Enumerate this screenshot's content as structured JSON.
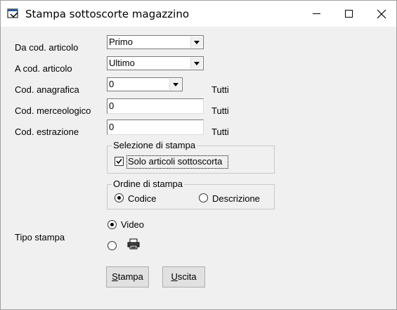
{
  "window": {
    "title": "Stampa sottoscorte magazzino",
    "icon": "app-window-icon",
    "controls": [
      "minimize-icon",
      "maximize-icon",
      "close-icon"
    ]
  },
  "fields": {
    "da_cod_articolo": {
      "label": "Da cod. articolo",
      "value": "Primo"
    },
    "a_cod_articolo": {
      "label": "A cod. articolo",
      "value": "Ultimo"
    },
    "cod_anagrafica": {
      "label": "Cod. anagrafica",
      "value": "0",
      "hint": "Tutti"
    },
    "cod_merceologico": {
      "label": "Cod. merceologico",
      "value": "0",
      "hint": "Tutti"
    },
    "cod_estrazione": {
      "label": "Cod. estrazione",
      "value": "0",
      "hint": "Tutti"
    }
  },
  "selezione": {
    "legend": "Selezione di stampa",
    "checkbox_label": "Solo articoli sottoscorta",
    "checked": true
  },
  "ordine": {
    "legend": "Ordine di stampa",
    "options": [
      "Codice",
      "Descrizione"
    ],
    "selected": "Codice"
  },
  "tipo_stampa": {
    "label": "Tipo stampa",
    "options": [
      "Video",
      "printer-icon"
    ],
    "selected": "Video"
  },
  "buttons": {
    "stampa": {
      "label_underlined": "S",
      "label_rest": "tampa"
    },
    "uscita": {
      "label_underlined": "U",
      "label_rest": "scita"
    }
  }
}
